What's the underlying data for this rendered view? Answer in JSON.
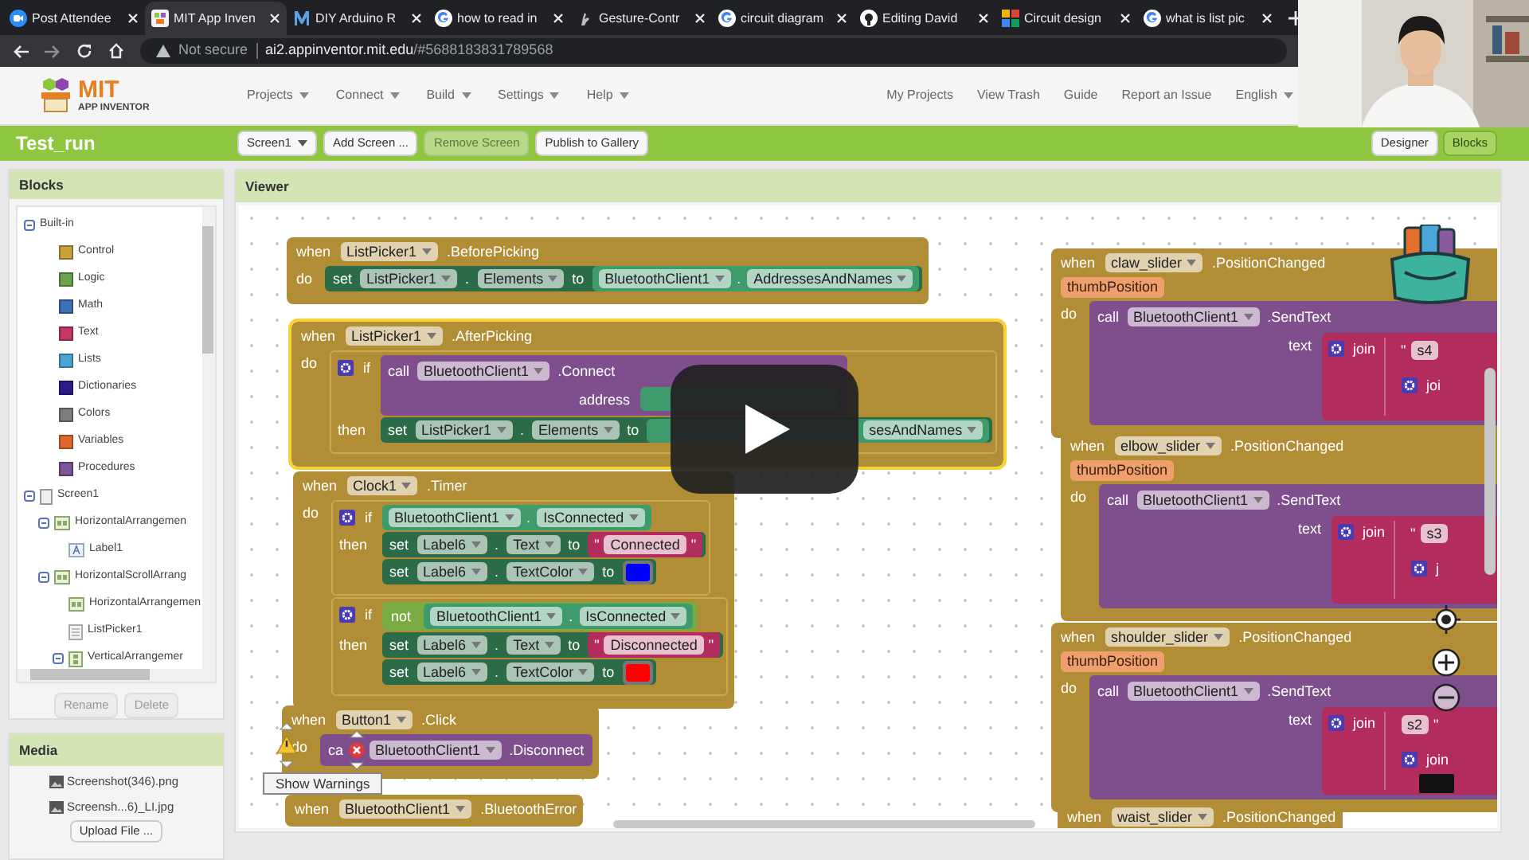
{
  "browser": {
    "tabs": [
      {
        "title": "Post Attendee",
        "selected": false
      },
      {
        "title": "MIT App Inven",
        "selected": true
      },
      {
        "title": "DIY Arduino R",
        "selected": false
      },
      {
        "title": "how to read in",
        "selected": false
      },
      {
        "title": "Gesture-Contr",
        "selected": false
      },
      {
        "title": "circuit diagram",
        "selected": false
      },
      {
        "title": "Editing David",
        "selected": false
      },
      {
        "title": "Circuit design",
        "selected": false
      },
      {
        "title": "what is list pic",
        "selected": false
      }
    ],
    "url": {
      "security": "Not secure",
      "host": "ai2.appinventor.mit.edu",
      "path": "/#5688183831789568"
    }
  },
  "app": {
    "logo": {
      "title": "MIT",
      "subtitle": "APP INVENTOR"
    },
    "menus": [
      "Projects",
      "Connect",
      "Build",
      "Settings",
      "Help"
    ],
    "links": [
      {
        "label": "My Projects",
        "dropdown": false
      },
      {
        "label": "View Trash",
        "dropdown": false
      },
      {
        "label": "Guide",
        "dropdown": false
      },
      {
        "label": "Report an Issue",
        "dropdown": false
      },
      {
        "label": "English",
        "dropdown": true
      }
    ]
  },
  "project": {
    "name": "Test_run",
    "buttons": [
      {
        "label": "Screen1",
        "dropdown": true,
        "disabled": false
      },
      {
        "label": "Add Screen ...",
        "dropdown": false,
        "disabled": false
      },
      {
        "label": "Remove Screen",
        "dropdown": false,
        "disabled": true
      },
      {
        "label": "Publish to Gallery",
        "dropdown": false,
        "disabled": false
      }
    ],
    "views": [
      {
        "label": "Designer",
        "selected": false
      },
      {
        "label": "Blocks",
        "selected": true
      }
    ]
  },
  "blocks_panel": {
    "title": "Blocks",
    "tree": [
      {
        "label": "Built-in",
        "kind": "folder",
        "expanded": true,
        "children": [
          {
            "label": "Control",
            "kind": "category",
            "color": "#c9a43a"
          },
          {
            "label": "Logic",
            "kind": "category",
            "color": "#6da34d"
          },
          {
            "label": "Math",
            "kind": "category",
            "color": "#3f6fb5"
          },
          {
            "label": "Text",
            "kind": "category",
            "color": "#c43760"
          },
          {
            "label": "Lists",
            "kind": "category",
            "color": "#49a6d4"
          },
          {
            "label": "Dictionaries",
            "kind": "category",
            "color": "#2d1b8c"
          },
          {
            "label": "Colors",
            "kind": "category",
            "color": "#7d7d7d"
          },
          {
            "label": "Variables",
            "kind": "category",
            "color": "#dd6a2c"
          },
          {
            "label": "Procedures",
            "kind": "category",
            "color": "#7c5594"
          }
        ]
      },
      {
        "label": "Screen1",
        "kind": "screen",
        "expanded": true,
        "children": [
          {
            "label": "HorizontalArrangemen",
            "kind": "arrangement",
            "expanded": true,
            "children": [
              {
                "label": "Label1",
                "kind": "label"
              }
            ]
          },
          {
            "label": "HorizontalScrollArrang",
            "kind": "arrangement",
            "expanded": true,
            "children": [
              {
                "label": "HorizontalArrangemen",
                "kind": "arrangement"
              },
              {
                "label": "ListPicker1",
                "kind": "picker"
              },
              {
                "label": "VerticalArrangemer",
                "kind": "vertical",
                "expanded": true
              }
            ]
          }
        ]
      }
    ],
    "buttons": [
      "Rename",
      "Delete"
    ]
  },
  "media": {
    "title": "Media",
    "files": [
      "Screenshot(346).png",
      "Screensh...6)_LI.jpg"
    ],
    "upload": "Upload File ..."
  },
  "viewer": {
    "title": "Viewer",
    "show_warnings": "Show Warnings",
    "scripts": [
      {
        "highlighted": false,
        "when": "when",
        "component": "ListPicker1",
        "event": ".BeforePicking",
        "do": "do",
        "body": [
          {
            "kind": "set",
            "set": "set",
            "component": "ListPicker1",
            "dot": ".",
            "property": "Elements",
            "to": "to",
            "value": {
              "kind": "getter",
              "component": "BluetoothClient1",
              "dot": ".",
              "property": "AddressesAndNames"
            }
          }
        ]
      },
      {
        "highlighted": true,
        "when": "when",
        "component": "ListPicker1",
        "event": ".AfterPicking",
        "do": "do",
        "body": [
          {
            "kind": "if",
            "if": "if",
            "condition": {
              "kind": "call",
              "call": "call",
              "component": "BluetoothClient1",
              "method": ".Connect",
              "args": [
                {
                  "name": "address",
                  "value": {
                    "kind": "covered"
                  }
                }
              ]
            },
            "then": "then",
            "body": [
              {
                "kind": "set",
                "set": "set",
                "component": "ListPicker1",
                "dot": ".",
                "property": "Elements",
                "to": "to",
                "value": {
                  "kind": "covered",
                  "text": "sesAndNames"
                }
              }
            ]
          }
        ]
      },
      {
        "highlighted": false,
        "when": "when",
        "component": "Clock1",
        "event": ".Timer",
        "do": "do",
        "body": [
          {
            "kind": "if",
            "if": "if",
            "condition": {
              "kind": "getter",
              "component": "BluetoothClient1",
              "dot": ".",
              "property": "IsConnected"
            },
            "then": "then",
            "body": [
              {
                "kind": "set",
                "set": "set",
                "component": "Label6",
                "dot": ".",
                "property": "Text",
                "to": "to",
                "value": {
                  "kind": "text",
                  "open": "\"",
                  "text": "Connected",
                  "close": "\""
                }
              },
              {
                "kind": "set",
                "set": "set",
                "component": "Label6",
                "dot": ".",
                "property": "TextColor",
                "to": "to",
                "value": {
                  "kind": "color",
                  "color": "#0000ff"
                }
              }
            ]
          },
          {
            "kind": "if",
            "if": "if",
            "condition": {
              "kind": "not",
              "not": "not",
              "operand": {
                "kind": "getter",
                "component": "BluetoothClient1",
                "dot": ".",
                "property": "IsConnected"
              }
            },
            "then": "then",
            "body": [
              {
                "kind": "set",
                "set": "set",
                "component": "Label6",
                "dot": ".",
                "property": "Text",
                "to": "to",
                "value": {
                  "kind": "text",
                  "open": "\"",
                  "text": "Disconnected",
                  "close": "\""
                }
              },
              {
                "kind": "set",
                "set": "set",
                "component": "Label6",
                "dot": ".",
                "property": "TextColor",
                "to": "to",
                "value": {
                  "kind": "color",
                  "color": "#ff0000"
                }
              }
            ]
          }
        ]
      },
      {
        "highlighted": false,
        "warning": true,
        "when": "when",
        "component": "Button1",
        "event": ".Click",
        "do": "do",
        "body": [
          {
            "kind": "call",
            "call": "ca",
            "error": true,
            "component": "BluetoothClient1",
            "method": ".Disconnect"
          }
        ]
      },
      {
        "highlighted": false,
        "when": "when",
        "component": "BluetoothClient1",
        "event": ".BluetoothError"
      },
      {
        "highlighted": false,
        "when": "when",
        "component": "claw_slider",
        "event": ".PositionChanged",
        "params": [
          "thumbPosition"
        ],
        "do": "do",
        "body": [
          {
            "kind": "call",
            "call": "call",
            "component": "BluetoothClient1",
            "method": ".SendText",
            "args": [
              {
                "name": "text",
                "value": {
                  "kind": "join",
                  "join": "join",
                  "items": [
                    {
                      "kind": "text",
                      "open": "\"",
                      "text": "s4"
                    },
                    {
                      "kind": "join",
                      "join": "joi"
                    }
                  ]
                }
              }
            ]
          }
        ]
      },
      {
        "highlighted": false,
        "when": "when",
        "component": "elbow_slider",
        "event": ".PositionChanged",
        "params": [
          "thumbPosition"
        ],
        "do": "do",
        "body": [
          {
            "kind": "call",
            "call": "call",
            "component": "BluetoothClient1",
            "method": ".SendText",
            "args": [
              {
                "name": "text",
                "value": {
                  "kind": "join",
                  "join": "join",
                  "items": [
                    {
                      "kind": "text",
                      "open": "\"",
                      "text": "s3"
                    },
                    {
                      "kind": "join",
                      "join": "j"
                    }
                  ]
                }
              }
            ]
          }
        ]
      },
      {
        "highlighted": false,
        "when": "when",
        "component": "shoulder_slider",
        "event": ".PositionChanged",
        "params": [
          "thumbPosition"
        ],
        "do": "do",
        "body": [
          {
            "kind": "call",
            "call": "call",
            "component": "BluetoothClient1",
            "method": ".SendText",
            "args": [
              {
                "name": "text",
                "value": {
                  "kind": "join",
                  "join": "join",
                  "items": [
                    {
                      "kind": "text",
                      "text": "s2",
                      "close": "\""
                    },
                    {
                      "kind": "join",
                      "join": "join"
                    }
                  ]
                }
              }
            ]
          }
        ]
      },
      {
        "highlighted": false,
        "when": "when",
        "component": "waist_slider",
        "event": ".PositionChanged"
      }
    ]
  }
}
